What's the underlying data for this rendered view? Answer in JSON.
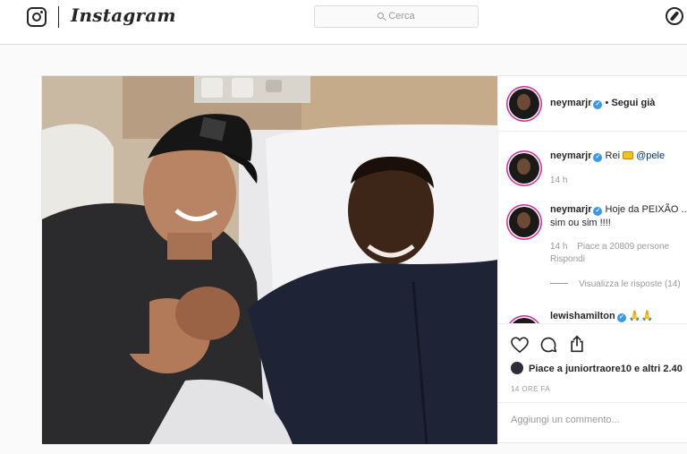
{
  "nav": {
    "logo_icon": "instagram-glyph-icon",
    "wordmark": "Instagram",
    "search_placeholder": "Cerca",
    "explore_icon": "compass-icon"
  },
  "post": {
    "author": "neymarjr",
    "follow_state": "Segui già",
    "comments": [
      {
        "user": "neymarjr",
        "text": "Rei",
        "emoji": "crown-emoji",
        "mention": "@pele",
        "time": "14 h"
      },
      {
        "user": "neymarjr",
        "text": "Hoje da PEIXÃO ...",
        "text2": "sim ou sim !!!!",
        "time": "14 h",
        "likes": "Piace a 20809 persone",
        "reply": "Rispondi",
        "view_replies": "Visualizza le risposte (14)"
      },
      {
        "user": "lewishamilton",
        "emoji": "folded-hands-emoji"
      }
    ],
    "likes_text": "Piace a juniortraore10 e altri 2.40",
    "timestamp": "14 ORE FA",
    "add_comment_placeholder": "Aggiungi un commento..."
  },
  "colors": {
    "verified": "#3897f0",
    "story_ring": "#d6249f",
    "muted": "#999999",
    "text": "#262626"
  }
}
